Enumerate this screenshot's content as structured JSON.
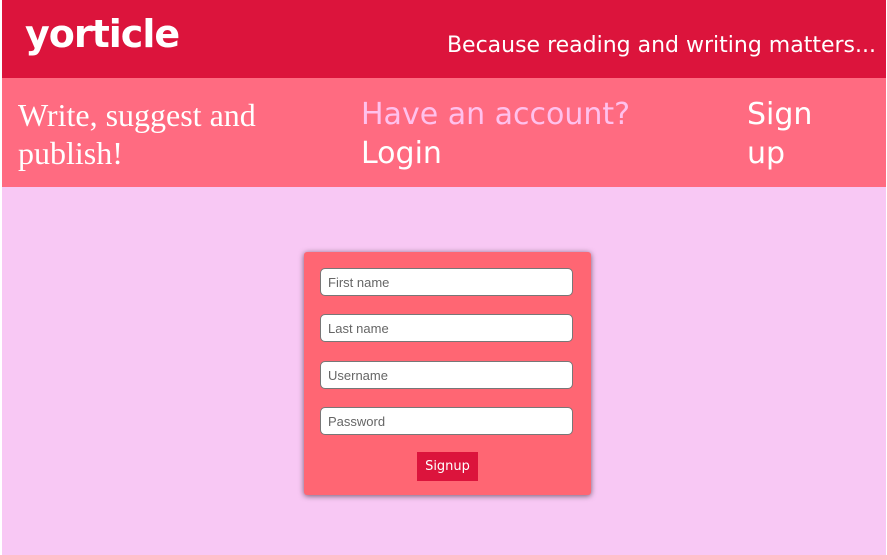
{
  "header": {
    "logo": "yorticle",
    "tagline": "Because reading and writing matters..."
  },
  "subheader": {
    "motto": "Write, suggest and publish!",
    "account_prompt": "Have an account?",
    "login_label": "Login",
    "signup_label": "Sign up"
  },
  "signup_form": {
    "first_name_placeholder": "First name",
    "last_name_placeholder": "Last name",
    "username_placeholder": "Username",
    "password_placeholder": "Password",
    "submit_label": "Signup"
  },
  "colors": {
    "brand_red": "#dc143c",
    "subbar_pink": "#ff6b81",
    "background_pink": "#f8c8f4",
    "form_card": "#ff6673",
    "account_prompt_text": "#ffc1ec"
  }
}
